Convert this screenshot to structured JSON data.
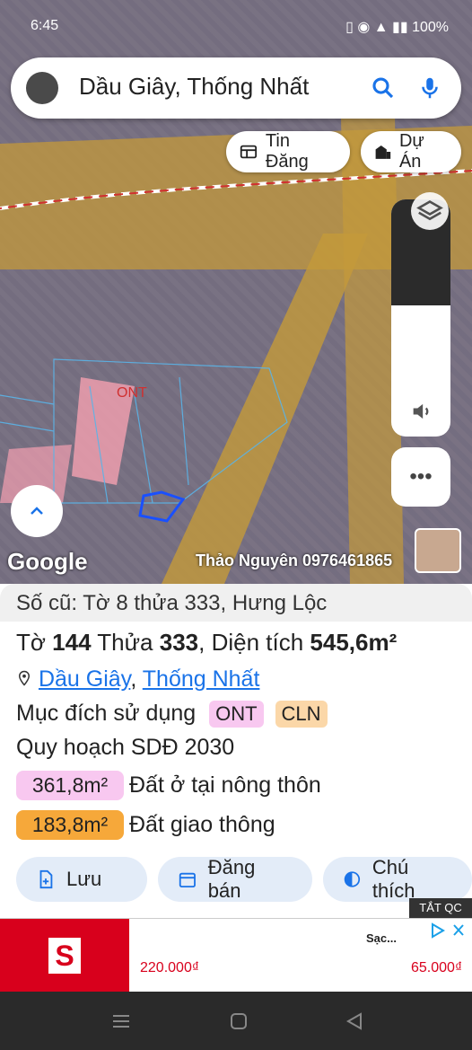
{
  "status": {
    "time": "6:45",
    "battery": "100%"
  },
  "search": {
    "query": "Dầu Giây, Thống Nhất"
  },
  "chips": {
    "news": "Tin Đăng",
    "project": "Dự Án"
  },
  "map": {
    "label_ont": "ONT",
    "google": "Google",
    "watermark": "Thảo Nguyên 0976461865"
  },
  "sheet": {
    "header": "Số cũ: Tờ 8 thửa 333, Hưng Lộc",
    "sheet_prefix": "Tờ ",
    "sheet_no": "144",
    "plot_prefix": " Thửa ",
    "plot_no": "333",
    "area_prefix": ", Diện tích ",
    "area_value": "545,6m²",
    "loc1": "Dầu Giây",
    "loc_sep": ", ",
    "loc2": "Thống Nhất",
    "purpose_label": "Mục đích sử dụng",
    "tag1": "ONT",
    "tag2": "CLN",
    "plan_label": "Quy hoạch SDĐ 2030",
    "rows": [
      {
        "area": "361,8m²",
        "label": "Đất ở tại nông thôn",
        "color": "#f8c8f0"
      },
      {
        "area": "183,8m²",
        "label": "Đất giao thông",
        "color": "#f6a83a"
      }
    ]
  },
  "buttons": {
    "save": "Lưu",
    "post": "Đăng bán",
    "legend": "Chú thích"
  },
  "ad": {
    "close_label": "TẮT QC",
    "title": "Sạc...",
    "price1": "220.000₫",
    "price2": "65.000₫"
  },
  "colors": {
    "accent": "#1a73e8",
    "purple_overlay": "#9a7fc4",
    "road_overlay": "#c49a3a"
  }
}
